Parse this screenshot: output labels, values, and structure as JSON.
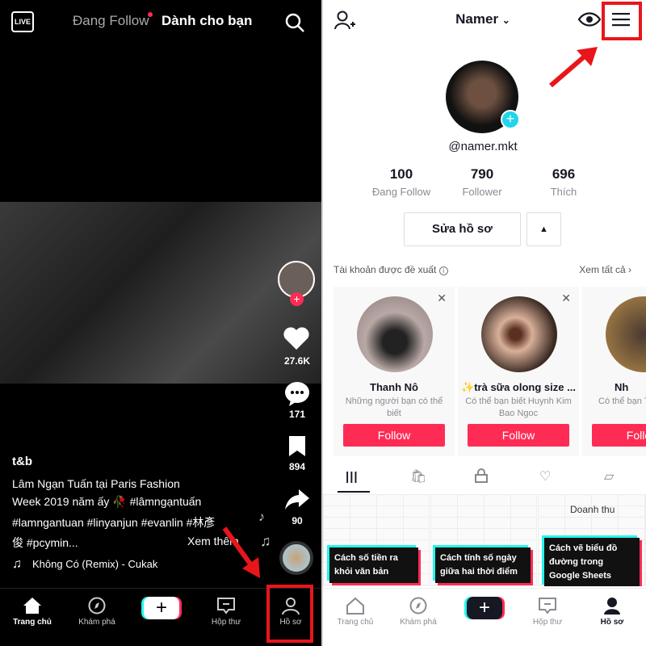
{
  "left": {
    "top_tabs": {
      "live": "LIVE",
      "following": "Đang Follow",
      "for_you": "Dành cho bạn"
    },
    "rail": {
      "likes": "27.6K",
      "comments": "171",
      "saves": "894",
      "shares": "90"
    },
    "caption": {
      "author": "t&b",
      "lines": [
        "Lâm Ngạn Tuấn tại Paris Fashion",
        "Week 2019 năm ấy 🥀 #lâmngạntuấn",
        "#lamngantuan #linyanjun #evanlin #林彥",
        "俊 #pcymin..."
      ],
      "see_more": "Xem thêm",
      "music": "Không Có (Remix) - Cukak"
    },
    "nav": [
      "Trang chủ",
      "Khám phá",
      "+",
      "Hộp thư",
      "Hồ sơ"
    ]
  },
  "right": {
    "username_title": "Namer",
    "handle": "@namer.mkt",
    "stats": [
      {
        "value": "100",
        "label": "Đang Follow"
      },
      {
        "value": "790",
        "label": "Follower"
      },
      {
        "value": "696",
        "label": "Thích"
      }
    ],
    "edit_profile": "Sửa hồ sơ",
    "suggested": {
      "title": "Tài khoản được đề xuất",
      "see_all": "Xem tất cả"
    },
    "cards": [
      {
        "name": "Thanh Nô",
        "desc": "Những người bạn có thể biết",
        "follow": "Follow"
      },
      {
        "name": "✨trà sữa olong size ...",
        "desc": "Có thể bạn biết Huynh Kim Bao Ngoc",
        "follow": "Follow"
      },
      {
        "name": "Nh",
        "desc": "Có thể bạn Thanh",
        "follow": "Follow"
      }
    ],
    "videos": [
      {
        "title": "Cách số tiền ra khỏi văn bản"
      },
      {
        "title": "Cách tính số ngày giữa hai thời điểm"
      },
      {
        "title": "Cách vẽ biểu đồ đường trong Google Sheets",
        "chart_title": "Doanh thu"
      }
    ],
    "nav": [
      "Trang chủ",
      "Khám phá",
      "+",
      "Hộp thư",
      "Hồ sơ"
    ]
  },
  "colors": {
    "accent": "#fe2c55",
    "cyan": "#25f4ee",
    "highlight": "#e8161b"
  }
}
